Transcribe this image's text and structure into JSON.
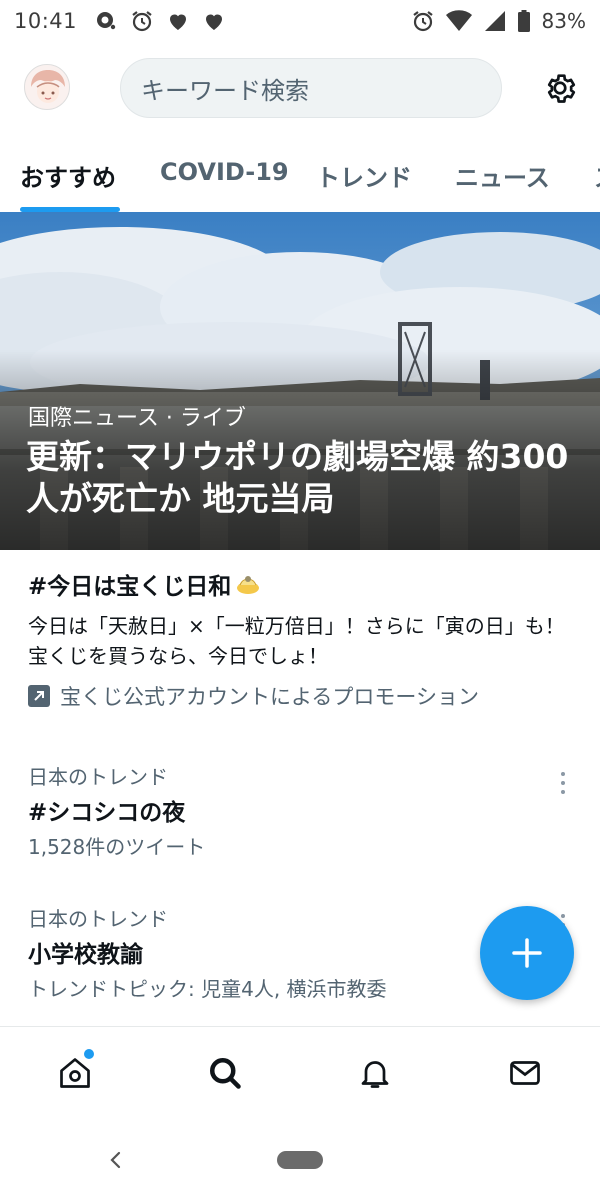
{
  "status_bar": {
    "time": "10:41",
    "battery": "83%",
    "left_icons": [
      "notification-icon",
      "alarm-icon",
      "heart-icon",
      "heart-icon"
    ],
    "right_icons": [
      "alarm-icon",
      "wifi-icon",
      "signal-icon",
      "battery-icon"
    ]
  },
  "header": {
    "search_placeholder": "キーワード検索"
  },
  "tabs": [
    {
      "label": "おすすめ",
      "active": true
    },
    {
      "label": "COVID-19",
      "active": false
    },
    {
      "label": "トレンド",
      "active": false
    },
    {
      "label": "ニュース",
      "active": false
    },
    {
      "label": "ス",
      "active": false
    }
  ],
  "hero": {
    "category": "国際ニュース · ライブ",
    "headline": "更新：マリウポリの劇場空爆 約300人が死亡か 地元当局"
  },
  "promo": {
    "title": "#今日は宝くじ日和",
    "description": "今日は「天赦日」×「一粒万倍日」！さらに「寅の日」も！宝くじを買うなら、今日でしょ！",
    "promoted_by": "宝くじ公式アカウントによるプロモーション"
  },
  "trends": [
    {
      "label": "日本のトレンド",
      "name": "#シコシコの夜",
      "meta": "1,528件のツイート"
    },
    {
      "label": "日本のトレンド",
      "name": "小学校教諭",
      "meta": "トレンドトピック: 児童4人, 横浜市教委"
    }
  ],
  "colors": {
    "accent": "#1d9bf0",
    "secondary_text": "#536471"
  }
}
